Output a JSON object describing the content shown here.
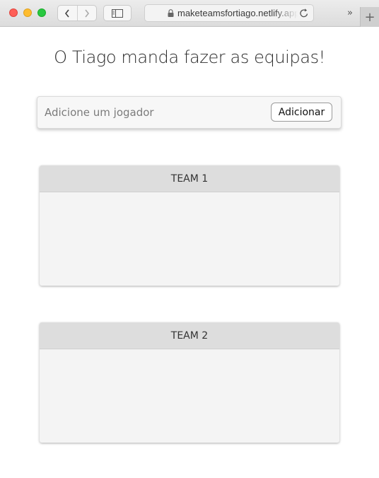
{
  "browser": {
    "url": "maketeamsfortiago.netlify.app",
    "icons": {
      "back": "chevron-left-icon",
      "forward": "chevron-right-icon",
      "sidebar": "sidebar-icon",
      "lock": "lock-icon",
      "reload": "reload-icon",
      "overflow": "double-chevron-right-icon",
      "new_tab": "plus-icon"
    },
    "overflow_label": "»",
    "new_tab_label": "+"
  },
  "page": {
    "title": "O Tiago manda fazer as equipas!",
    "add_player": {
      "placeholder": "Adicione um jogador",
      "button_label": "Adicionar"
    },
    "teams": [
      {
        "name": "TEAM 1",
        "players": []
      },
      {
        "name": "TEAM 2",
        "players": []
      }
    ]
  }
}
